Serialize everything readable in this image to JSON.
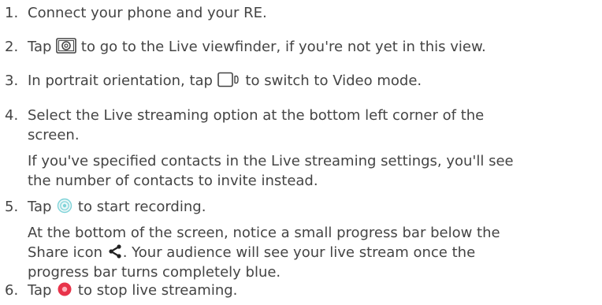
{
  "steps": [
    {
      "number": "1.",
      "lines": [
        "Connect your phone and your RE."
      ]
    },
    {
      "number": "2.",
      "pre": "Tap ",
      "icon": "camera-viewfinder-icon",
      "post": " to go to the Live viewfinder, if you're not yet in this view."
    },
    {
      "number": "3.",
      "pre": "In portrait orientation, tap ",
      "icon": "video-mode-icon",
      "post": " to switch to Video mode."
    },
    {
      "number": "4.",
      "lines": [
        "Select the Live streaming option at the bottom left corner of the",
        "screen.",
        "If you've specified contacts in the Live streaming settings, you'll see",
        "the number of contacts to invite instead."
      ]
    },
    {
      "number": "5.",
      "pre": "Tap ",
      "icon": "start-recording-icon",
      "post": " to start recording.",
      "note_lines": [
        "At the bottom of the screen, notice a small progress bar below the"
      ],
      "note_pre": "Share icon ",
      "note_icon": "share-icon",
      "note_post": ". Your audience will see your live stream once the",
      "note_last": "progress bar turns completely blue."
    },
    {
      "number": "6.",
      "pre": "Tap ",
      "icon": "stop-streaming-icon",
      "post": " to stop live streaming."
    }
  ],
  "colors": {
    "text": "#444444",
    "record_ring": "#7fd3d8",
    "stop_red": "#e8334a"
  }
}
